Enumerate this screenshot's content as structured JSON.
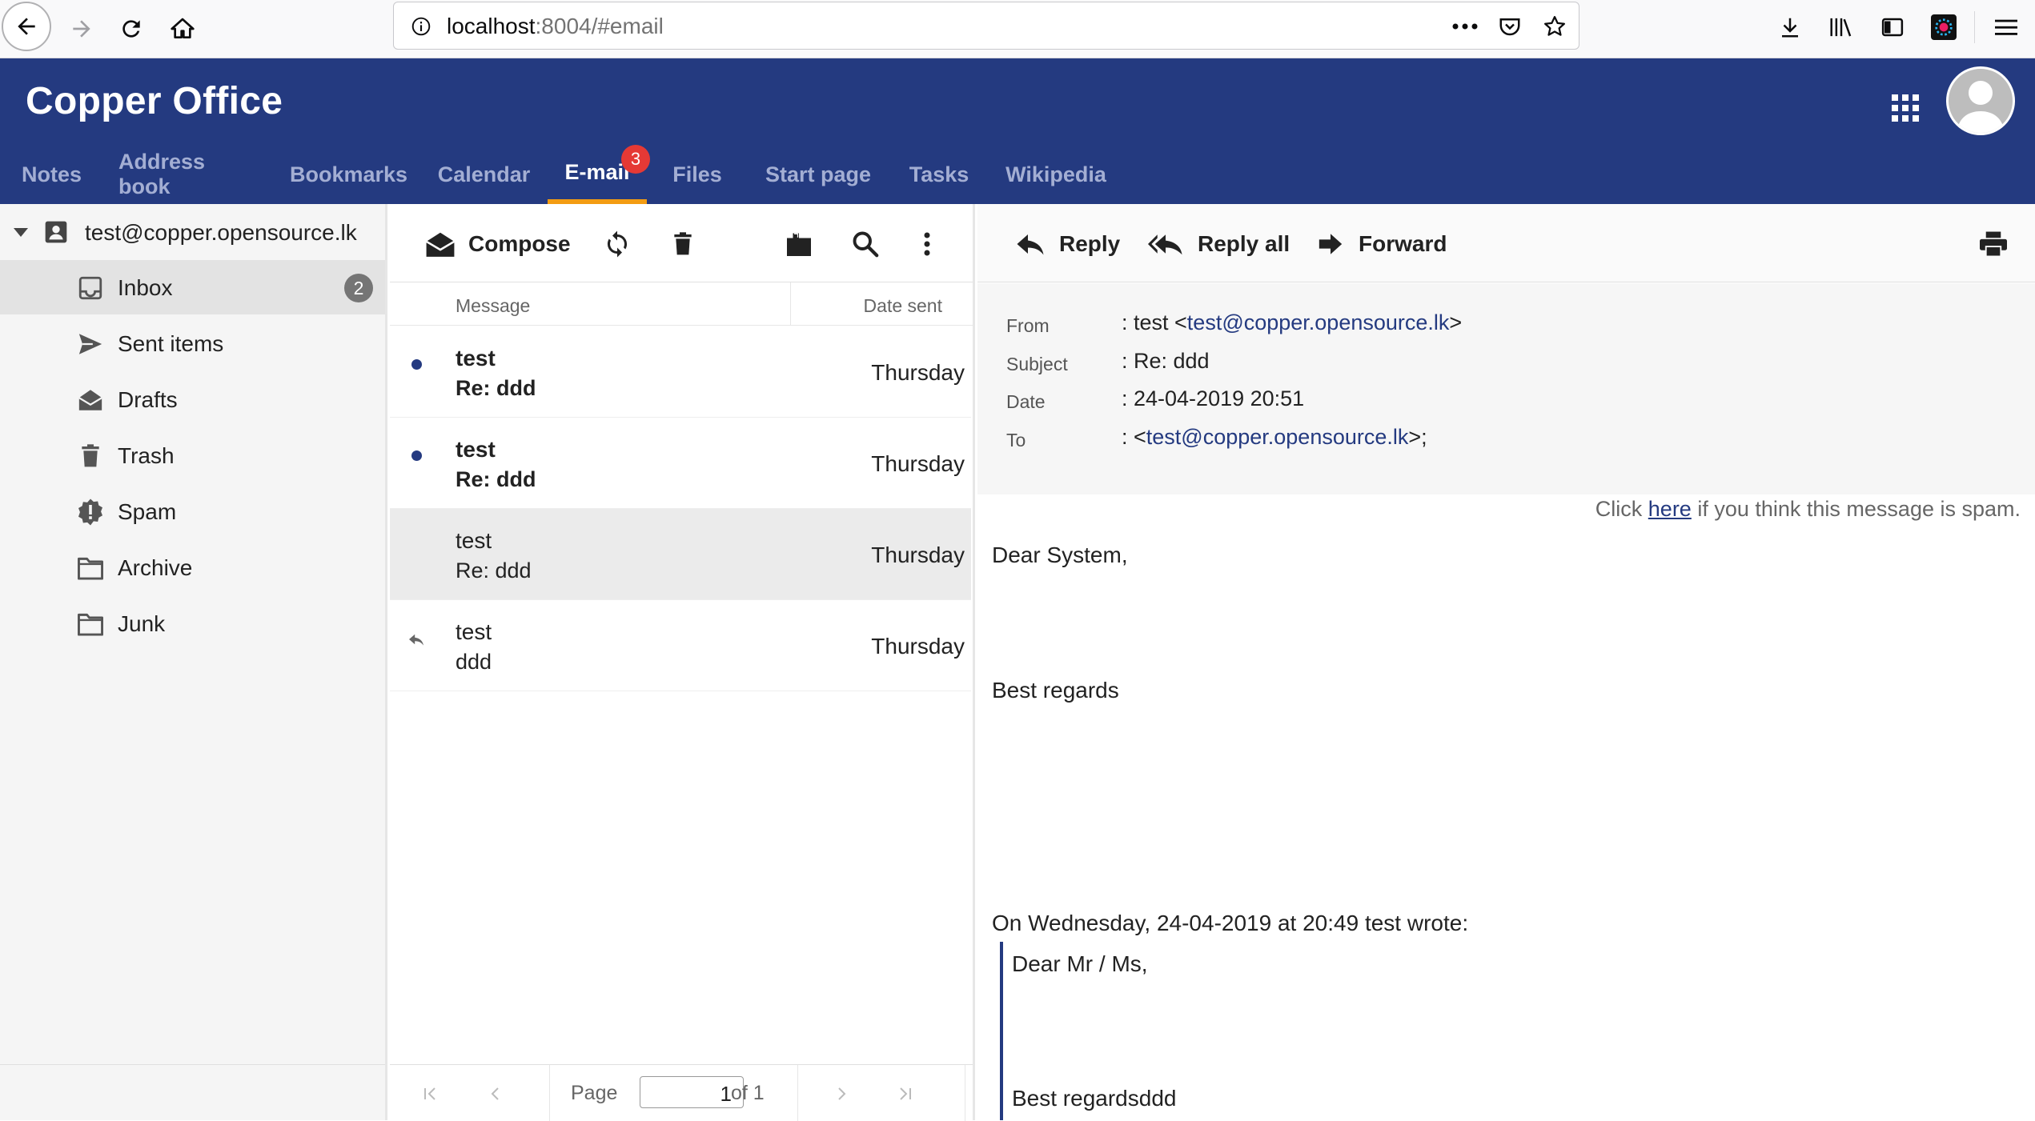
{
  "browser": {
    "url_host": "localhost",
    "url_rest": ":8004/#email"
  },
  "app": {
    "title": "Copper Office"
  },
  "tabs": [
    {
      "label": "Notes"
    },
    {
      "label": "Address book"
    },
    {
      "label": "Bookmarks"
    },
    {
      "label": "Calendar"
    },
    {
      "label": "E-mail",
      "badge": "3"
    },
    {
      "label": "Files"
    },
    {
      "label": "Start page"
    },
    {
      "label": "Tasks"
    },
    {
      "label": "Wikipedia"
    }
  ],
  "sidebar": {
    "account": "test@copper.opensource.lk",
    "folders": [
      {
        "label": "Inbox",
        "icon": "inbox-icon",
        "badge": "2",
        "selected": true
      },
      {
        "label": "Sent items",
        "icon": "send-icon"
      },
      {
        "label": "Drafts",
        "icon": "drafts-icon"
      },
      {
        "label": "Trash",
        "icon": "trash-icon"
      },
      {
        "label": "Spam",
        "icon": "spam-icon"
      },
      {
        "label": "Archive",
        "icon": "folder-icon"
      },
      {
        "label": "Junk",
        "icon": "folder-icon"
      }
    ]
  },
  "list": {
    "compose_label": "Compose",
    "col_message": "Message",
    "col_date": "Date sent",
    "messages": [
      {
        "sender": "test",
        "subject": "Re: ddd",
        "date": "Thursday",
        "unread": true
      },
      {
        "sender": "test",
        "subject": "Re: ddd",
        "date": "Thursday",
        "unread": true
      },
      {
        "sender": "test",
        "subject": "Re: ddd",
        "date": "Thursday",
        "selected": true
      },
      {
        "sender": "test",
        "subject": "ddd",
        "date": "Thursday",
        "replied": true
      }
    ],
    "pager": {
      "page_label": "Page",
      "page_value": "1",
      "of_label": "of 1"
    }
  },
  "reader": {
    "reply_label": "Reply",
    "reply_all_label": "Reply all",
    "forward_label": "Forward",
    "headers": {
      "from_key": "From",
      "from_prefix": ": test <",
      "from_email": "test@copper.opensource.lk",
      "from_suffix": ">",
      "subject_key": "Subject",
      "subject_val": ": Re: ddd",
      "date_key": "Date",
      "date_val": ": 24-04-2019 20:51",
      "to_key": "To",
      "to_prefix": ": <",
      "to_email": "test@copper.opensource.lk",
      "to_suffix": ">;"
    },
    "spam_before": "Click ",
    "spam_link": "here",
    "spam_after": " if you think this message is spam.",
    "body": {
      "greeting": "Dear System,",
      "regards": "Best regards",
      "quote_intro": "On Wednesday, 24-04-2019 at 20:49 test wrote:",
      "quote_greeting": "Dear Mr / Ms,",
      "quote_regards": "Best regardsddd"
    }
  },
  "colors": {
    "brand": "#243a80",
    "tab_indicator": "#f39c12",
    "badge_red": "#e53935"
  }
}
